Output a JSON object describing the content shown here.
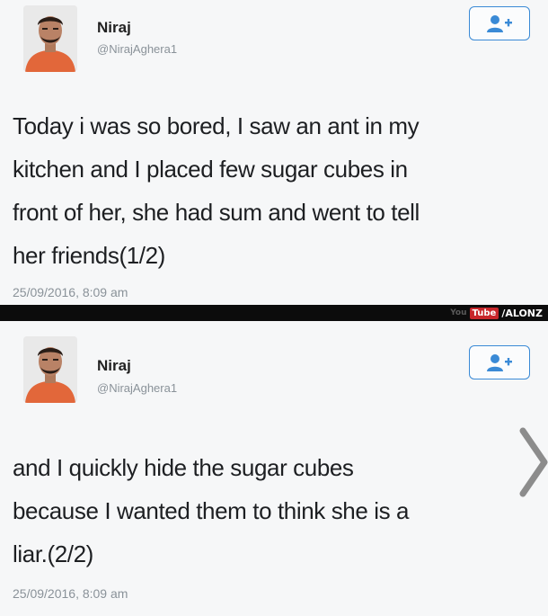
{
  "tweets": [
    {
      "name": "Niraj",
      "handle": "@NirajAghera1",
      "lines": [
        "Today i was so bored, I saw an ant in my",
        "kitchen and I placed few sugar cubes in",
        "front of her, she had sum and went to tell",
        "her friends(1/2)"
      ],
      "timestamp": "25/09/2016, 8:09 am",
      "follow_icon": "follow-person-plus-icon"
    },
    {
      "name": "Niraj",
      "handle": "@NirajAghera1",
      "lines": [
        "and I quickly hide the sugar cubes",
        "because I wanted them to think she is a",
        "liar.(2/2)"
      ],
      "timestamp": "25/09/2016, 8:09 am",
      "follow_icon": "follow-person-plus-icon"
    }
  ],
  "watermark": {
    "prefix": "You",
    "tube": "Tube",
    "suffix": "/ALONZ"
  },
  "colors": {
    "accent": "#3a8ad6",
    "background": "#f6f7f8",
    "text": "#1d1f22",
    "muted": "#8a9299"
  }
}
